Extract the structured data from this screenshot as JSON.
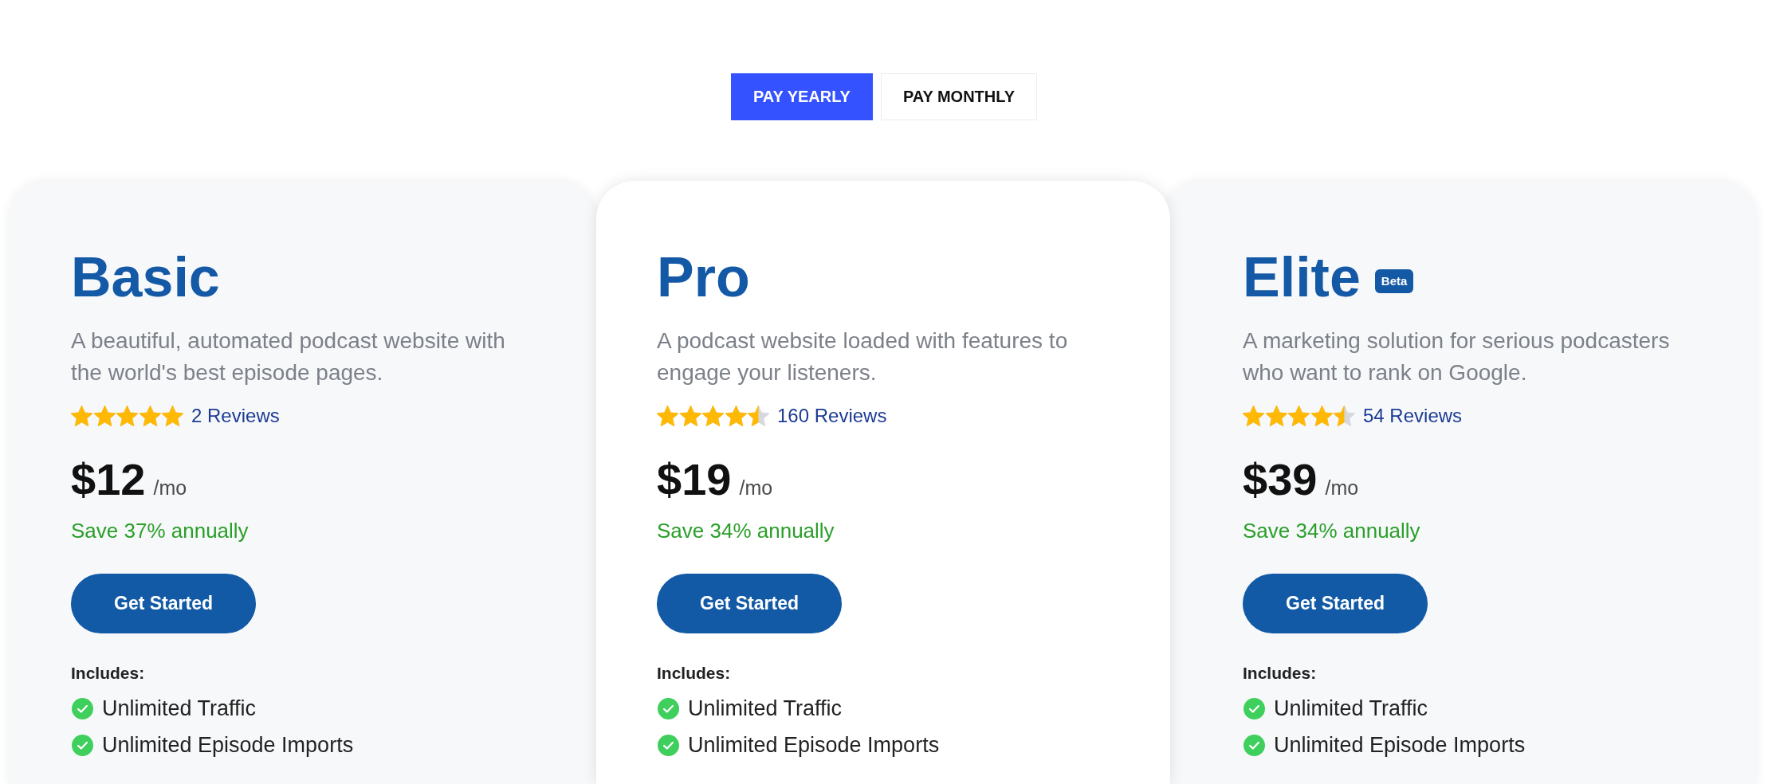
{
  "billing_toggle": [
    {
      "label": "PAY YEARLY",
      "selected": true
    },
    {
      "label": "PAY MONTHLY",
      "selected": false
    }
  ],
  "plans": [
    {
      "name": "Basic",
      "featured": false,
      "description": "A beautiful, automated podcast website with the world's best episode pages.",
      "stars": 5,
      "reviews": "2 Reviews",
      "price": "$12",
      "period": "/mo",
      "savings": "Save 37% annually",
      "button": "Get Started",
      "includes_label": "Includes:",
      "features": [
        "Unlimited Traffic",
        "Unlimited Episode Imports"
      ]
    },
    {
      "name": "Pro",
      "featured": true,
      "description": "A podcast website loaded with features to engage your listeners.",
      "stars": 4.5,
      "reviews": "160 Reviews",
      "price": "$19",
      "period": "/mo",
      "savings": "Save 34% annually",
      "button": "Get Started",
      "includes_label": "Includes:",
      "features": [
        "Unlimited Traffic",
        "Unlimited Episode Imports"
      ]
    },
    {
      "name": "Elite",
      "badge": "Beta",
      "featured": false,
      "description": "A marketing solution for serious podcasters who want to rank on Google.",
      "stars": 4.5,
      "reviews": "54 Reviews",
      "price": "$39",
      "period": "/mo",
      "savings": "Save 34% annually",
      "button": "Get Started",
      "includes_label": "Includes:",
      "features": [
        "Unlimited Traffic",
        "Unlimited Episode Imports"
      ]
    }
  ]
}
